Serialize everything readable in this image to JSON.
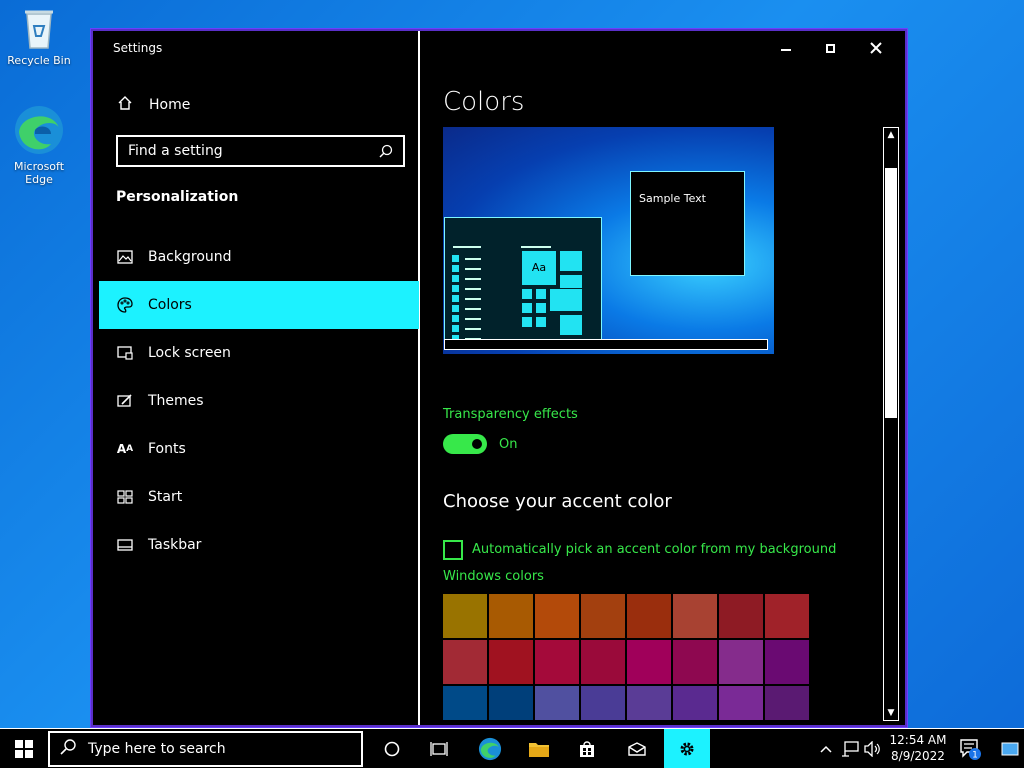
{
  "desktop": {
    "recycle_bin_label": "Recycle Bin",
    "edge_label_line1": "Microsoft",
    "edge_label_line2": "Edge"
  },
  "window": {
    "title": "Settings",
    "page_title": "Colors"
  },
  "sidebar": {
    "home_label": "Home",
    "search_placeholder": "Find a setting",
    "section_title": "Personalization",
    "items": [
      {
        "label": "Background",
        "icon": "image-icon"
      },
      {
        "label": "Colors",
        "icon": "palette-icon",
        "active": true
      },
      {
        "label": "Lock screen",
        "icon": "lock-screen-icon"
      },
      {
        "label": "Themes",
        "icon": "brush-icon"
      },
      {
        "label": "Fonts",
        "icon": "fonts-icon"
      },
      {
        "label": "Start",
        "icon": "start-icon"
      },
      {
        "label": "Taskbar",
        "icon": "taskbar-icon"
      }
    ]
  },
  "preview": {
    "sample_text": "Sample Text",
    "tile_text": "Aa"
  },
  "transparency": {
    "label": "Transparency effects",
    "state": "On"
  },
  "accent": {
    "heading": "Choose your accent color",
    "auto_label": "Automatically pick an accent color from my background",
    "windows_colors_label": "Windows colors",
    "swatches": [
      "#997300",
      "#a85a02",
      "#b34a0a",
      "#a3400f",
      "#9a2e0d",
      "#a84232",
      "#8e1b24",
      "#a02229",
      "#a22a35",
      "#a01220",
      "#a40a3a",
      "#9a0a3a",
      "#a0005a",
      "#8e0850",
      "#852c8c",
      "#6a0a72",
      "#004a88",
      "#003f7a",
      "#5050a0",
      "#4a3c96",
      "#5a3c96",
      "#5a2a90",
      "#7a2a96",
      "#5a1a72"
    ]
  },
  "taskbar": {
    "search_placeholder": "Type here to search",
    "time": "12:54 AM",
    "date": "8/9/2022",
    "notification_count": "1"
  },
  "colors": {
    "accent": "#1cf2ff",
    "highlight_text": "#37e84a",
    "window_border": "#5a2fc9"
  }
}
